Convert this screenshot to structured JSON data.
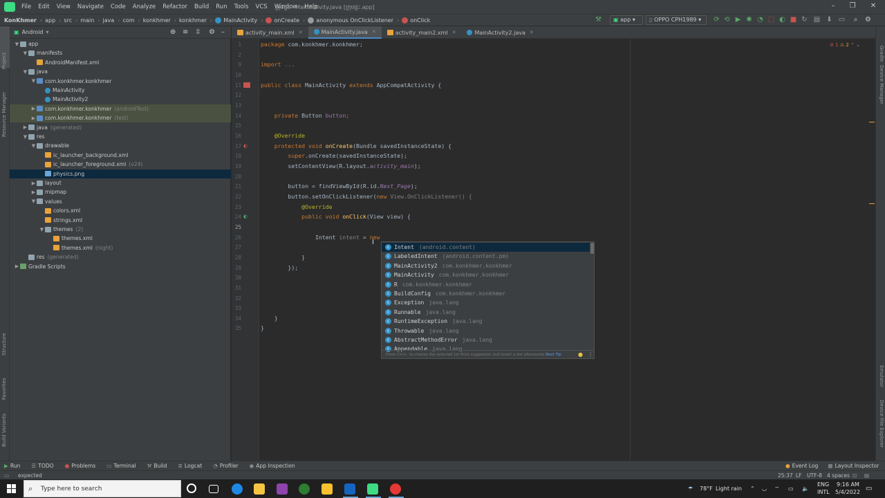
{
  "menu": {
    "items": [
      "File",
      "Edit",
      "View",
      "Navigate",
      "Code",
      "Analyze",
      "Refactor",
      "Build",
      "Run",
      "Tools",
      "VCS",
      "Window",
      "Help"
    ],
    "window_title": "ក្រុមផ្ទះ - MainActivity.java [ក្រុមផ្ទះ.app]"
  },
  "breadcrumbs": [
    "KonKhmer",
    "app",
    "src",
    "main",
    "java",
    "com",
    "konkhmer",
    "konkhmer",
    "MainActivity",
    "onCreate",
    "anonymous OnClickListener",
    "onClick"
  ],
  "toolbar": {
    "config": "app",
    "device": "OPPO CPH1989"
  },
  "project": {
    "view_select": "Android",
    "tree": [
      {
        "depth": 0,
        "arrow": "▼",
        "icon": "fold",
        "label": "app",
        "suffix": ""
      },
      {
        "depth": 1,
        "arrow": "▼",
        "icon": "fold",
        "label": "manifests",
        "suffix": ""
      },
      {
        "depth": 2,
        "arrow": "",
        "icon": "xml",
        "label": "AndroidManifest.xml",
        "suffix": ""
      },
      {
        "depth": 1,
        "arrow": "▼",
        "icon": "fold",
        "label": "java",
        "suffix": ""
      },
      {
        "depth": 2,
        "arrow": "▼",
        "icon": "foldb",
        "label": "com.konkhmer.konkhmer",
        "suffix": ""
      },
      {
        "depth": 3,
        "arrow": "",
        "icon": "jc",
        "label": "MainActivity",
        "suffix": ""
      },
      {
        "depth": 3,
        "arrow": "",
        "icon": "jc",
        "label": "MainActivity2",
        "suffix": ""
      },
      {
        "depth": 2,
        "arrow": "▶",
        "icon": "foldb",
        "label": "com.konkhmer.konkhmer",
        "suffix": "(androidTest)",
        "hl": true
      },
      {
        "depth": 2,
        "arrow": "▶",
        "icon": "foldb",
        "label": "com.konkhmer.konkhmer",
        "suffix": "(test)",
        "hl": true
      },
      {
        "depth": 1,
        "arrow": "▶",
        "icon": "fold",
        "label": "java",
        "suffix": "(generated)"
      },
      {
        "depth": 1,
        "arrow": "▼",
        "icon": "fold",
        "label": "res",
        "suffix": ""
      },
      {
        "depth": 2,
        "arrow": "▼",
        "icon": "fold",
        "label": "drawable",
        "suffix": ""
      },
      {
        "depth": 3,
        "arrow": "",
        "icon": "xml",
        "label": "ic_launcher_background.xml",
        "suffix": ""
      },
      {
        "depth": 3,
        "arrow": "",
        "icon": "xml",
        "label": "ic_launcher_foreground.xml",
        "suffix": "(v24)"
      },
      {
        "depth": 3,
        "arrow": "",
        "icon": "png",
        "label": "physics.png",
        "suffix": "",
        "sel": true
      },
      {
        "depth": 2,
        "arrow": "▶",
        "icon": "fold",
        "label": "layout",
        "suffix": ""
      },
      {
        "depth": 2,
        "arrow": "▶",
        "icon": "fold",
        "label": "mipmap",
        "suffix": ""
      },
      {
        "depth": 2,
        "arrow": "▼",
        "icon": "fold",
        "label": "values",
        "suffix": ""
      },
      {
        "depth": 3,
        "arrow": "",
        "icon": "xml",
        "label": "colors.xml",
        "suffix": ""
      },
      {
        "depth": 3,
        "arrow": "",
        "icon": "xml",
        "label": "strings.xml",
        "suffix": ""
      },
      {
        "depth": 3,
        "arrow": "▼",
        "icon": "fold",
        "label": "themes",
        "suffix": "(2)"
      },
      {
        "depth": 4,
        "arrow": "",
        "icon": "xml",
        "label": "themes.xml",
        "suffix": ""
      },
      {
        "depth": 4,
        "arrow": "",
        "icon": "xml",
        "label": "themes.xml",
        "suffix": "(night)"
      },
      {
        "depth": 1,
        "arrow": "",
        "icon": "fold",
        "label": "res",
        "suffix": "(generated)"
      },
      {
        "depth": 0,
        "arrow": "▶",
        "icon": "gradle",
        "label": "Gradle Scripts",
        "suffix": ""
      }
    ]
  },
  "tabs": [
    {
      "label": "activity_main.xml",
      "icon": "xml",
      "active": false
    },
    {
      "label": "MainActivity.java",
      "icon": "jc",
      "active": true
    },
    {
      "label": "activity_main2.xml",
      "icon": "xml",
      "active": false
    },
    {
      "label": "MainActivity2.java",
      "icon": "jc",
      "active": false
    }
  ],
  "editor": {
    "line_numbers": [
      "1",
      "2",
      "9",
      "10",
      "11",
      "12",
      "13",
      "14",
      "15",
      "16",
      "17",
      "18",
      "19",
      "20",
      "21",
      "22",
      "23",
      "24",
      "25",
      "26",
      "27",
      "28",
      "29",
      "30",
      "31",
      "32",
      "33",
      "34",
      "35"
    ],
    "lines": [
      [
        {
          "t": "package ",
          "c": "kw"
        },
        {
          "t": "com.konkhmer.konkhmer;",
          "c": ""
        }
      ],
      [],
      [
        {
          "t": "import ",
          "c": "kw"
        },
        {
          "t": "...",
          "c": "grey"
        }
      ],
      [],
      [
        {
          "t": "public class ",
          "c": "kw"
        },
        {
          "t": "MainActivity ",
          "c": ""
        },
        {
          "t": "extends ",
          "c": "kw"
        },
        {
          "t": "AppCompatActivity {",
          "c": ""
        }
      ],
      [],
      [],
      [
        {
          "t": "    private ",
          "c": "kw"
        },
        {
          "t": "Button ",
          "c": ""
        },
        {
          "t": "button",
          "c": "fld"
        },
        {
          "t": ";",
          "c": "kw"
        }
      ],
      [],
      [
        {
          "t": "    @Override",
          "c": "ann"
        }
      ],
      [
        {
          "t": "    protected void ",
          "c": "kw"
        },
        {
          "t": "onCreate",
          "c": "fn"
        },
        {
          "t": "(Bundle savedInstanceState) {",
          "c": ""
        }
      ],
      [
        {
          "t": "        super",
          "c": "kw"
        },
        {
          "t": ".onCreate(savedInstanceState);",
          "c": ""
        }
      ],
      [
        {
          "t": "        setContentView(R.layout.",
          "c": ""
        },
        {
          "t": "activity_main",
          "c": "fld it"
        },
        {
          "t": ");",
          "c": ""
        }
      ],
      [],
      [
        {
          "t": "        button ",
          "c": ""
        },
        {
          "t": "= findViewById(R.id.",
          "c": ""
        },
        {
          "t": "Next_Page",
          "c": "fld it"
        },
        {
          "t": ");",
          "c": ""
        }
      ],
      [
        {
          "t": "        button",
          "c": ""
        },
        {
          "t": ".setOnClickListener(",
          "c": ""
        },
        {
          "t": "new ",
          "c": "kw"
        },
        {
          "t": "View.OnClickListener() {",
          "c": "grey"
        }
      ],
      [
        {
          "t": "            @Override",
          "c": "ann"
        }
      ],
      [
        {
          "t": "            public void ",
          "c": "kw"
        },
        {
          "t": "onClick",
          "c": "fn"
        },
        {
          "t": "(View view) {",
          "c": ""
        }
      ],
      [],
      [
        {
          "t": "                Intent ",
          "c": ""
        },
        {
          "t": "intent ",
          "c": "grey"
        },
        {
          "t": "= ",
          "c": ""
        },
        {
          "t": "new",
          "c": "kw"
        }
      ],
      [],
      [
        {
          "t": "            }",
          "c": ""
        }
      ],
      [
        {
          "t": "        });",
          "c": ""
        }
      ],
      [],
      [],
      [],
      [],
      [
        {
          "t": "    }",
          "c": ""
        }
      ],
      [
        {
          "t": "}",
          "c": ""
        }
      ]
    ],
    "inspection": "1",
    "warnings": "2"
  },
  "popup": {
    "items": [
      {
        "name": "Intent",
        "pkg": "(android.content)"
      },
      {
        "name": "LabeledIntent",
        "pkg": "(android.content.pm)"
      },
      {
        "name": "MainActivity2",
        "pkg": "com.konkhmer.konkhmer"
      },
      {
        "name": "MainActivity",
        "pkg": "com.konkhmer.konkhmer"
      },
      {
        "name": "R",
        "pkg": "com.konkhmer.konkhmer"
      },
      {
        "name": "BuildConfig",
        "pkg": "com.konkhmer.konkhmer"
      },
      {
        "name": "Exception",
        "pkg": "java.lang"
      },
      {
        "name": "Runnable",
        "pkg": "java.lang"
      },
      {
        "name": "RuntimeException",
        "pkg": "java.lang"
      },
      {
        "name": "Throwable",
        "pkg": "java.lang"
      },
      {
        "name": "AbstractMethodError",
        "pkg": "java.lang"
      },
      {
        "name": "Appendable",
        "pkg": "java.lang"
      }
    ],
    "footer_text": "Press Ctrl+. to choose the selected (or first) suggestion and insert a dot afterwards",
    "next_tip": "Next Tip"
  },
  "bottom_tools": [
    "Run",
    "TODO",
    "Problems",
    "Terminal",
    "Build",
    "Logcat",
    "Profiler",
    "App Inspection"
  ],
  "bottom_right_tools": [
    "Event Log",
    "Layout Inspector"
  ],
  "status": {
    "message": "expected",
    "position": "25:37",
    "line_sep": "LF",
    "encoding": "UTF-8",
    "indent": "4 spaces"
  },
  "left_strip": [
    "Project",
    "Resource Manager",
    "Structure",
    "Favorites",
    "Build Variants"
  ],
  "right_strip": [
    "Gradle",
    "Device Manager",
    "Emulator",
    "Device File Explorer"
  ],
  "taskbar": {
    "search_placeholder": "Type here to search",
    "weather_temp": "78°F",
    "weather_desc": "Light rain",
    "lang_top": "ENG",
    "lang_bottom": "INTL",
    "time": "9:16 AM",
    "date": "5/4/2022"
  },
  "colors": {
    "accent": "#4a88c7",
    "android_green": "#3ddc84",
    "keyword": "#cc7832",
    "annotation": "#bbb529"
  }
}
